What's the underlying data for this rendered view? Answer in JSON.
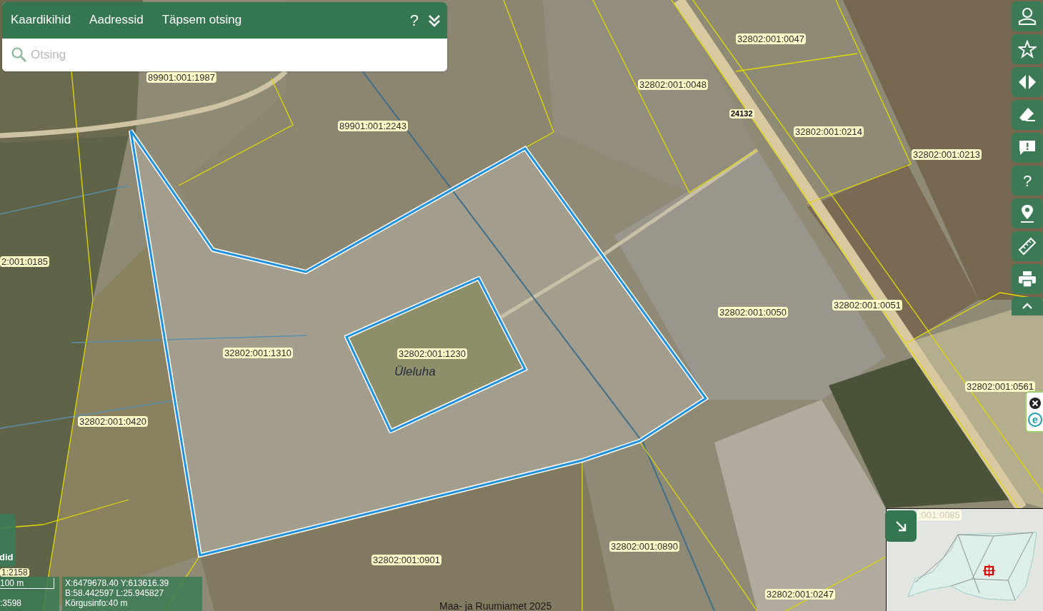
{
  "search_panel": {
    "tabs": [
      {
        "label": "Kaardikihid",
        "selected": false
      },
      {
        "label": "Aadressid",
        "selected": false
      },
      {
        "label": "Täpsem otsing",
        "selected": false
      }
    ],
    "help": "?",
    "placeholder": "Otsing"
  },
  "map_labels": [
    {
      "text": "89901:001:1987",
      "kind": "parcel"
    },
    {
      "text": "89901:001:2243",
      "kind": "parcel"
    },
    {
      "text": "32802:001:0047",
      "kind": "parcel"
    },
    {
      "text": "32802:001:0048",
      "kind": "parcel"
    },
    {
      "text": "24132",
      "kind": "road"
    },
    {
      "text": "32802:001:0214",
      "kind": "parcel"
    },
    {
      "text": "32802:001:0213",
      "kind": "parcel"
    },
    {
      "text": "2:001:0185",
      "kind": "parcel"
    },
    {
      "text": "32802:001:1310",
      "kind": "parcel"
    },
    {
      "text": "32802:001:1230",
      "kind": "parcel"
    },
    {
      "text": "Üleluha",
      "kind": "place"
    },
    {
      "text": "32802:001:0050",
      "kind": "parcel"
    },
    {
      "text": "32802:001:0051",
      "kind": "parcel"
    },
    {
      "text": "32802:001:0561",
      "kind": "parcel"
    },
    {
      "text": "32802:001:0420",
      "kind": "parcel"
    },
    {
      "text": "32802:001:0890",
      "kind": "parcel"
    },
    {
      "text": "32802:001:0901",
      "kind": "parcel"
    },
    {
      "text": "32802:001:0247",
      "kind": "parcel"
    },
    {
      "text": ":001:0085",
      "kind": "faded"
    }
  ],
  "toolbar": {
    "help": "?"
  },
  "widget": {
    "logo": "e"
  },
  "layers_tab": "did",
  "scale": {
    "ratio_label": "1:2158",
    "bar": "100 m",
    "ratio": ":3598"
  },
  "coordinates": [
    "X:6479678.40 Y:613616.39",
    "B:58.442597 L:25.945827",
    "Kõrgusinfo:40 m"
  ],
  "attribution": "Maa- ja Ruumiamet 2025"
}
